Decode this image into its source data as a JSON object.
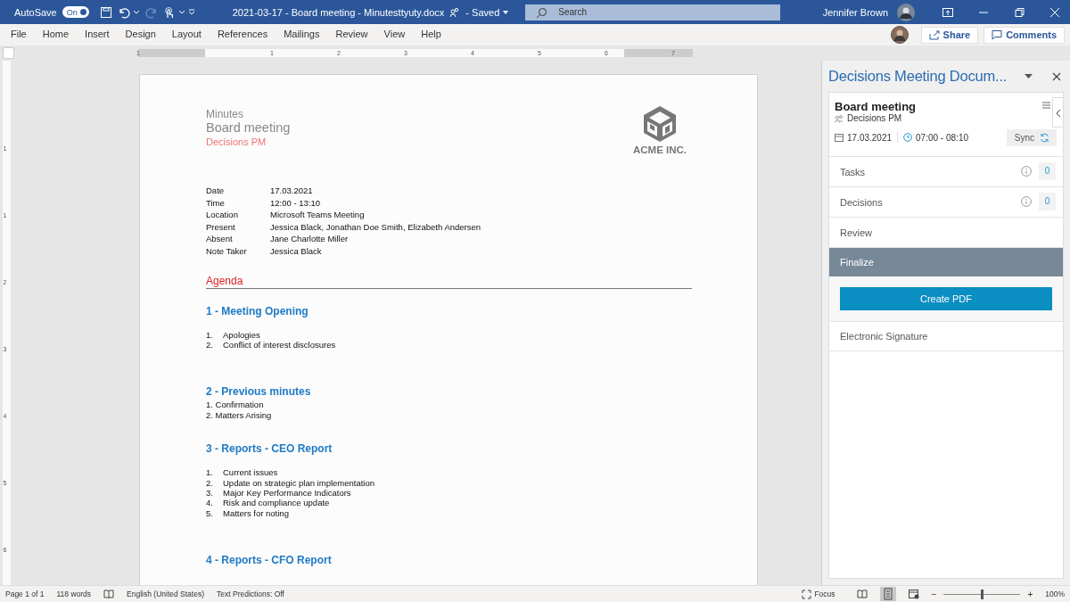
{
  "titlebar": {
    "autosave_label": "AutoSave",
    "autosave": {
      "on": true,
      "label": "On"
    },
    "document_title": "2021-03-17 - Board meeting - Minutesttyuty.docx",
    "save_state": "- Saved",
    "search": {
      "placeholder": "Search"
    },
    "user_name": "Jennifer Brown"
  },
  "ribbon_tabs": [
    {
      "label": "File",
      "selected": false
    },
    {
      "label": "Home",
      "selected": false
    },
    {
      "label": "Insert",
      "selected": false
    },
    {
      "label": "Design",
      "selected": false
    },
    {
      "label": "Layout",
      "selected": false
    },
    {
      "label": "References",
      "selected": false
    },
    {
      "label": "Mailings",
      "selected": false
    },
    {
      "label": "Review",
      "selected": false
    },
    {
      "label": "View",
      "selected": false
    },
    {
      "label": "Help",
      "selected": false
    }
  ],
  "ribbon_buttons": [
    "Share",
    "Comments"
  ],
  "ruler": {
    "labels": [
      "1",
      "1",
      "2",
      "3",
      "4",
      "5",
      "6",
      "7"
    ],
    "vertical_labels": [
      "1",
      "1",
      "2",
      "3",
      "4",
      "5",
      "6"
    ]
  },
  "document": {
    "kicker": "Minutes",
    "title": "Board meeting",
    "subtitle": "Decisions PM",
    "logo_text": "ACME INC.",
    "details": [
      {
        "label": "Date",
        "value": "17.03.2021"
      },
      {
        "label": "Time",
        "value": "12:00 - 13:10"
      },
      {
        "label": "Location",
        "value": "Microsoft Teams Meeting"
      },
      {
        "label": "Present",
        "value": "Jessica Black, Jonathan Doe Smith, Elizabeth Andersen"
      },
      {
        "label": "Absent",
        "value": "Jane Charlotte Miller"
      },
      {
        "label": "Note Taker",
        "value": "Jessica Black"
      }
    ],
    "agenda_heading": "Agenda",
    "sections": [
      {
        "heading": "1 - Meeting Opening",
        "kind": "tabbed",
        "items": [
          {
            "number": "1.",
            "text": "Apologies"
          },
          {
            "number": "2.",
            "text": "Conflict of interest disclosures"
          }
        ]
      },
      {
        "heading": "2 - Previous minutes",
        "kind": "inline",
        "items": [
          {
            "number": "1.",
            "text": "Confirmation"
          },
          {
            "number": "2.",
            "text": "Matters Arising"
          }
        ]
      },
      {
        "heading": "3 - Reports - CEO Report",
        "kind": "tabbed",
        "items": [
          {
            "number": "1.",
            "text": "Current issues"
          },
          {
            "number": "2.",
            "text": "Update on strategic plan implementation"
          },
          {
            "number": "3.",
            "text": "Major Key Performance Indicators"
          },
          {
            "number": "4.",
            "text": "Risk and compliance update"
          },
          {
            "number": "5.",
            "text": "Matters for noting"
          }
        ]
      },
      {
        "heading": "4 - Reports - CFO Report"
      }
    ]
  },
  "pane": {
    "title": "Decisions Meeting Docum...",
    "meeting_title": "Board meeting",
    "group": "Decisions PM",
    "date": "17.03.2021",
    "time": "07:00 - 08:10",
    "sync_button": "Sync",
    "sections": [
      {
        "label": "Tasks",
        "count": "0",
        "selected": false
      },
      {
        "label": "Decisions",
        "count": "0",
        "selected": false
      },
      {
        "label": "Review",
        "selected": false
      },
      {
        "label": "Finalize",
        "selected": true,
        "button": "Create PDF"
      },
      {
        "label": "Electronic Signature",
        "selected": false
      }
    ]
  },
  "status_bar": {
    "items": [
      "Page 1 of 1",
      "118 words",
      "English (United States)",
      "Text Predictions: Off"
    ],
    "focus": "Focus",
    "zoom": {
      "level": 0.5,
      "label": "100%",
      "out": "−",
      "in": "+"
    }
  }
}
